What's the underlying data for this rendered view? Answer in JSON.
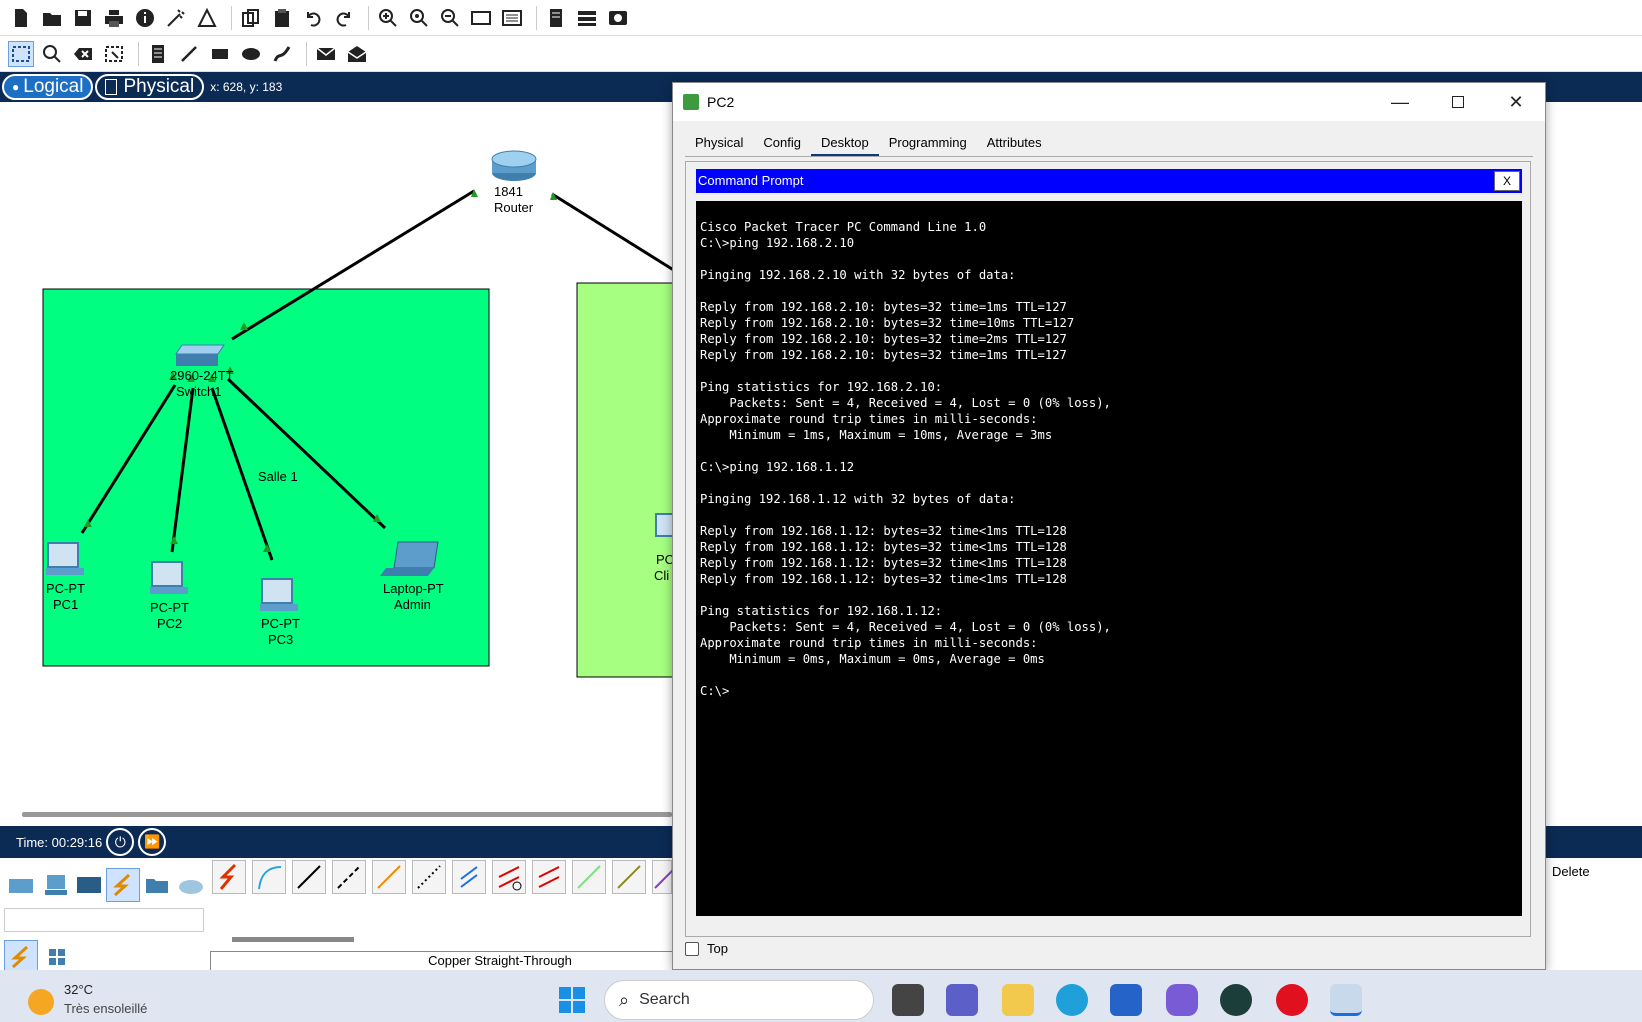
{
  "toolbar_top": {
    "icons": [
      "new-file-icon",
      "open-folder-icon",
      "save-icon",
      "print-icon",
      "info-icon",
      "wizard-icon",
      "network-info-icon",
      "copy-icon",
      "paste-icon",
      "undo-icon",
      "redo-icon",
      "zoom-in-icon",
      "zoom-reset-icon",
      "zoom-out-icon",
      "palette-icon",
      "viewport-icon",
      "custom-device-icon",
      "cluster-icon",
      "screenshot-icon"
    ]
  },
  "toolbar_second": {
    "icons": [
      "select-icon",
      "inspect-icon",
      "delete-icon",
      "resize-icon",
      "note-icon",
      "line-icon",
      "rectangle-icon",
      "ellipse-icon",
      "freeform-icon",
      "simple-pdu-icon",
      "complex-pdu-icon"
    ]
  },
  "modebar": {
    "logical_label": "Logical",
    "physical_label": "Physical",
    "coords": "x: 628, y: 183"
  },
  "topology": {
    "router": {
      "model": "1841",
      "name": "Router"
    },
    "switch": {
      "model": "2960-24TT",
      "name": "Switch1"
    },
    "room_label": "Salle 1",
    "devices": [
      {
        "type": "PC-PT",
        "name": "PC1"
      },
      {
        "type": "PC-PT",
        "name": "PC2"
      },
      {
        "type": "PC-PT",
        "name": "PC3"
      },
      {
        "type": "Laptop-PT",
        "name": "Admin"
      }
    ],
    "partial_right": {
      "type": "PC",
      "name": "Cli"
    },
    "colors": {
      "salle1": "#00ff80",
      "salle2": "#a6ff80",
      "link_up": "#1f9c1f"
    }
  },
  "timebar": {
    "time": "Time: 00:29:16"
  },
  "palette": {
    "cable_selected": "Copper Straight-Through",
    "delete_label": "Delete"
  },
  "pc_window": {
    "title": "PC2",
    "tabs": [
      "Physical",
      "Config",
      "Desktop",
      "Programming",
      "Attributes"
    ],
    "active_tab": "Desktop",
    "cmd_title": "Command Prompt",
    "cmd_close": "X",
    "top_checkbox": "Top",
    "terminal_lines": [
      "Cisco Packet Tracer PC Command Line 1.0",
      "C:\\>ping 192.168.2.10",
      "",
      "Pinging 192.168.2.10 with 32 bytes of data:",
      "",
      "Reply from 192.168.2.10: bytes=32 time=1ms TTL=127",
      "Reply from 192.168.2.10: bytes=32 time=10ms TTL=127",
      "Reply from 192.168.2.10: bytes=32 time=2ms TTL=127",
      "Reply from 192.168.2.10: bytes=32 time=1ms TTL=127",
      "",
      "Ping statistics for 192.168.2.10:",
      "    Packets: Sent = 4, Received = 4, Lost = 0 (0% loss),",
      "Approximate round trip times in milli-seconds:",
      "    Minimum = 1ms, Maximum = 10ms, Average = 3ms",
      "",
      "C:\\>ping 192.168.1.12",
      "",
      "Pinging 192.168.1.12 with 32 bytes of data:",
      "",
      "Reply from 192.168.1.12: bytes=32 time<1ms TTL=128",
      "Reply from 192.168.1.12: bytes=32 time<1ms TTL=128",
      "Reply from 192.168.1.12: bytes=32 time<1ms TTL=128",
      "Reply from 192.168.1.12: bytes=32 time<1ms TTL=128",
      "",
      "Ping statistics for 192.168.1.12:",
      "    Packets: Sent = 4, Received = 4, Lost = 0 (0% loss),",
      "Approximate round trip times in milli-seconds:",
      "    Minimum = 0ms, Maximum = 0ms, Average = 0ms",
      "",
      "C:\\>"
    ]
  },
  "taskbar": {
    "temperature": "32°C",
    "weather": "Très ensoleillé",
    "search_placeholder": "Search",
    "apps": [
      "start-icon",
      "task-view-icon",
      "teams-icon",
      "file-explorer-icon",
      "edge-icon",
      "store-icon",
      "copilot-icon",
      "app-icon",
      "opera-icon",
      "packet-tracer-icon"
    ]
  },
  "colors": {
    "navy": "#0b2b55",
    "cmd_header": "#0000ff"
  }
}
